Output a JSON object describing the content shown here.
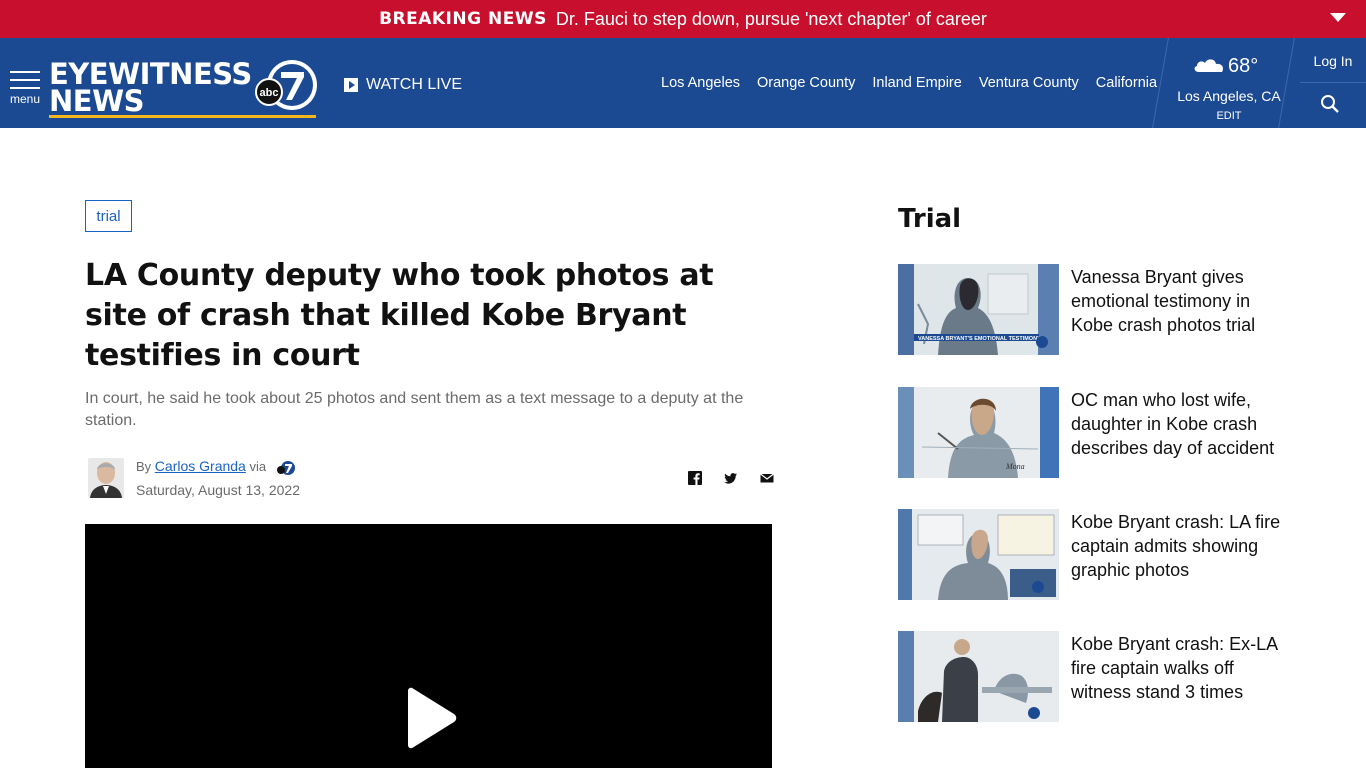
{
  "breaking": {
    "label": "BREAKING NEWS",
    "headline": "Dr. Fauci to step down, pursue 'next chapter' of career"
  },
  "header": {
    "menu_label": "menu",
    "logo_line1": "EYEWITNESS",
    "logo_line2": "NEWS",
    "logo_badge": "abc",
    "watch_live": "WATCH LIVE",
    "nav": [
      "Los Angeles",
      "Orange County",
      "Inland Empire",
      "Ventura County",
      "California"
    ],
    "weather": {
      "temp": "68°",
      "location": "Los Angeles, CA",
      "edit": "EDIT"
    },
    "login": "Log In"
  },
  "article": {
    "tag": "trial",
    "title": "LA County deputy who took photos at site of crash that killed Kobe Bryant testifies in court",
    "description": "In court, he said he took about 25 photos and sent them as a text message to a deputy at the station.",
    "by": "By",
    "author": "Carlos Granda",
    "via": "via",
    "date": "Saturday, August 13, 2022"
  },
  "sidebar": {
    "title": "Trial",
    "items": [
      {
        "headline": "Vanessa Bryant gives emotional testimony in Kobe crash photos trial",
        "caption": "VANESSA BRYANT'S EMOTIONAL TESTIMONY"
      },
      {
        "headline": "OC man who lost wife, daughter in Kobe crash describes day of accident"
      },
      {
        "headline": "Kobe Bryant crash: LA fire captain admits showing graphic photos"
      },
      {
        "headline": "Kobe Bryant crash: Ex-LA fire captain walks off witness stand 3 times"
      }
    ]
  },
  "colors": {
    "breaking_red": "#c8102e",
    "header_blue": "#1b4a93",
    "link_blue": "#1b62c7",
    "accent_gold": "#f5b81c"
  },
  "icons": [
    "chevron-down-icon",
    "hamburger-menu-icon",
    "play-icon",
    "cloud-icon",
    "search-icon",
    "facebook-icon",
    "twitter-icon",
    "email-icon"
  ]
}
